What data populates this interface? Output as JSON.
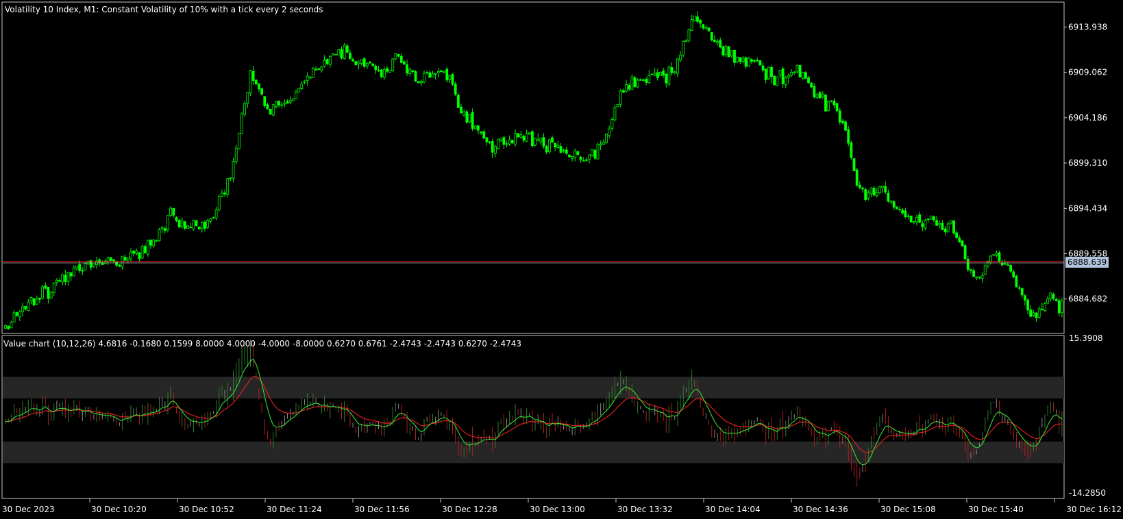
{
  "window": {
    "title": "Volatility 10 Index, M1:  Constant Volatility of 10% with a tick every 2 seconds",
    "current_price_label": "6888.639"
  },
  "colors": {
    "background": "#000000",
    "frame": "#c8c8c8",
    "candle_up": "#00ff00",
    "candle_down": "#00ff00",
    "price_line": "#ff2020",
    "osc_fast": "#33dd33",
    "osc_slow": "#ee2222",
    "osc_bar_up": "#2e7d2e",
    "osc_bar_down": "#b01e1e",
    "osc_bar_neutral": "#8a8a8a",
    "band_fill": "#262626",
    "price_tag_bg": "#b0c4de"
  },
  "chart_data": [
    {
      "type": "candlestick",
      "title": "Volatility 10 Index, M1:  Constant Volatility of 10% with a tick every 2 seconds",
      "ylim": [
        6881.2,
        6916.4
      ],
      "y_ticks": [
        "6913.938",
        "6909.062",
        "6904.186",
        "6899.310",
        "6894.434",
        "6889.558",
        "6884.682"
      ],
      "current_price": 6888.639,
      "x_ticks": [
        "30 Dec 2023",
        "30 Dec 10:20",
        "30 Dec 10:52",
        "30 Dec 11:24",
        "30 Dec 11:56",
        "30 Dec 12:28",
        "30 Dec 13:00",
        "30 Dec 13:32",
        "30 Dec 14:04",
        "30 Dec 14:36",
        "30 Dec 15:08",
        "30 Dec 15:40",
        "30 Dec 16:12"
      ],
      "path_keypoints": [
        {
          "bar": 0,
          "price": 6882.0
        },
        {
          "bar": 12,
          "price": 6885.5
        },
        {
          "bar": 22,
          "price": 6887.2
        },
        {
          "bar": 32,
          "price": 6888.8
        },
        {
          "bar": 40,
          "price": 6888.6
        },
        {
          "bar": 52,
          "price": 6890.8
        },
        {
          "bar": 58,
          "price": 6894.2
        },
        {
          "bar": 62,
          "price": 6892.5
        },
        {
          "bar": 72,
          "price": 6893.0
        },
        {
          "bar": 80,
          "price": 6899.0
        },
        {
          "bar": 86,
          "price": 6909.0
        },
        {
          "bar": 92,
          "price": 6905.0
        },
        {
          "bar": 100,
          "price": 6906.5
        },
        {
          "bar": 112,
          "price": 6910.5
        },
        {
          "bar": 120,
          "price": 6911.0
        },
        {
          "bar": 132,
          "price": 6909.0
        },
        {
          "bar": 138,
          "price": 6910.5
        },
        {
          "bar": 144,
          "price": 6908.0
        },
        {
          "bar": 154,
          "price": 6909.5
        },
        {
          "bar": 160,
          "price": 6905.0
        },
        {
          "bar": 170,
          "price": 6901.5
        },
        {
          "bar": 184,
          "price": 6902.0
        },
        {
          "bar": 196,
          "price": 6900.5
        },
        {
          "bar": 204,
          "price": 6899.5
        },
        {
          "bar": 210,
          "price": 6902.0
        },
        {
          "bar": 218,
          "price": 6908.0
        },
        {
          "bar": 226,
          "price": 6908.2
        },
        {
          "bar": 234,
          "price": 6909.0
        },
        {
          "bar": 242,
          "price": 6915.0
        },
        {
          "bar": 248,
          "price": 6913.0
        },
        {
          "bar": 256,
          "price": 6910.8
        },
        {
          "bar": 264,
          "price": 6910.2
        },
        {
          "bar": 270,
          "price": 6908.0
        },
        {
          "bar": 278,
          "price": 6909.5
        },
        {
          "bar": 284,
          "price": 6906.5
        },
        {
          "bar": 292,
          "price": 6905.5
        },
        {
          "bar": 300,
          "price": 6896.5
        },
        {
          "bar": 308,
          "price": 6896.0
        },
        {
          "bar": 318,
          "price": 6893.0
        },
        {
          "bar": 326,
          "price": 6893.2
        },
        {
          "bar": 334,
          "price": 6892.0
        },
        {
          "bar": 340,
          "price": 6887.0
        },
        {
          "bar": 348,
          "price": 6889.5
        },
        {
          "bar": 354,
          "price": 6887.0
        },
        {
          "bar": 360,
          "price": 6882.5
        },
        {
          "bar": 366,
          "price": 6884.8
        },
        {
          "bar": 371,
          "price": 6883.5
        }
      ],
      "bars": 372
    },
    {
      "type": "oscillator",
      "title": "Value chart (10,12,26) 4.6816 -0.1680 0.1599 8.0000 4.0000 -4.0000 -8.0000 0.6270 0.6761 -2.4743 -2.4743 0.6270 -2.4743",
      "ylim": [
        -14.285,
        15.3908
      ],
      "y_ticks": [
        "15.3908",
        "-14.2850"
      ],
      "levels": [
        8,
        4,
        -4,
        -8
      ],
      "last_values": {
        "fast": 0.627,
        "slow": -2.4743
      }
    }
  ]
}
